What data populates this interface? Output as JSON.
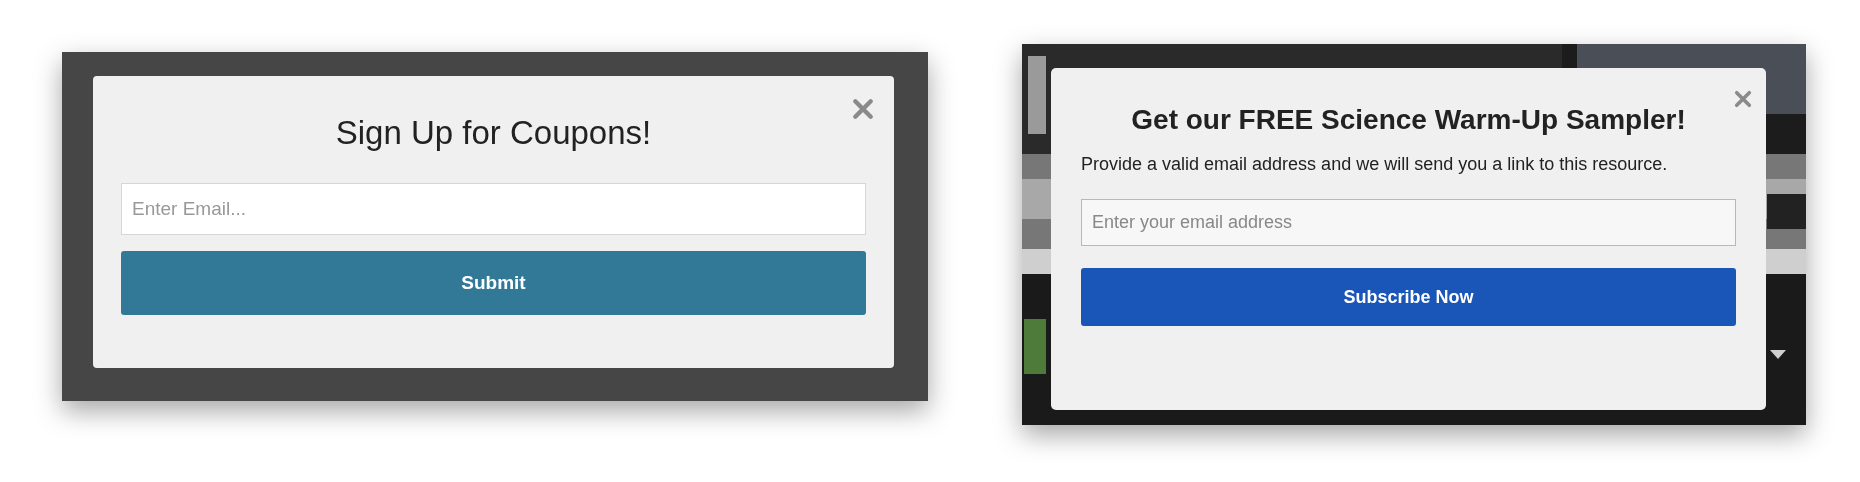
{
  "popups": [
    {
      "kind": "coupon",
      "title": "Sign Up for Coupons!",
      "email_field": {
        "placeholder": "Enter Email..."
      },
      "button": "Submit"
    },
    {
      "kind": "sampler",
      "title": "Get our FREE Science Warm-Up Sampler!",
      "description": "Provide a valid email address and we will send you a link to this resource.",
      "email_field": {
        "placeholder": "Enter your email address"
      },
      "button": "Subscribe Now"
    }
  ]
}
